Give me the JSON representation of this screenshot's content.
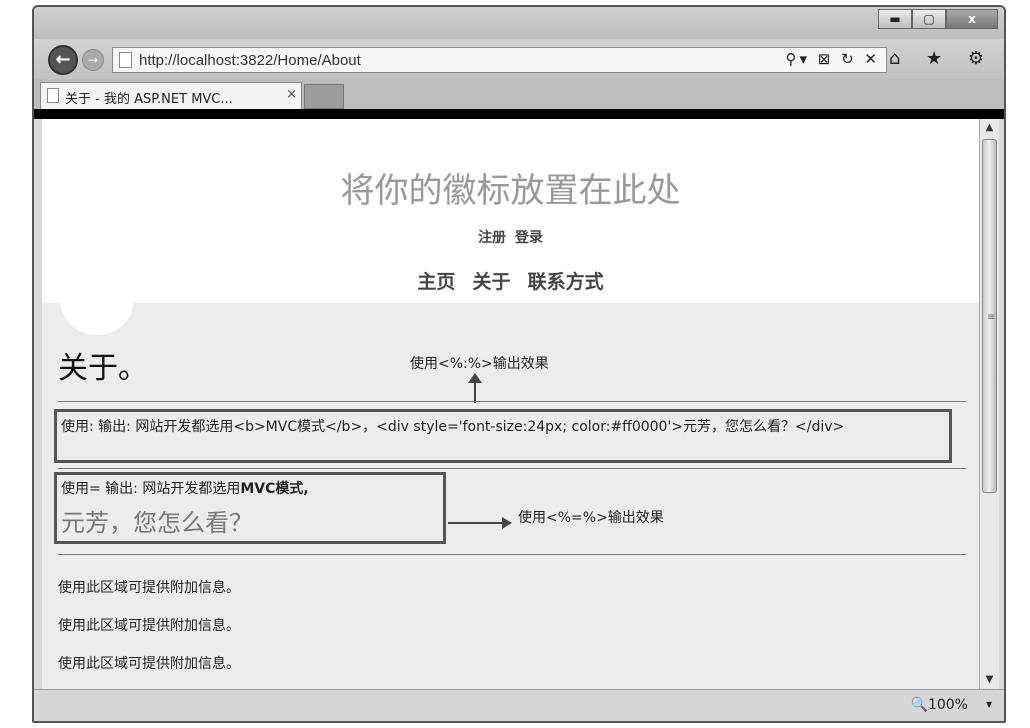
{
  "browser": {
    "url": "http://localhost:3822/Home/About",
    "tab_title": "关于 - 我的 ASP.NET MVC...",
    "tab_close": "×",
    "back_glyph": "←",
    "forward_glyph": "→",
    "address_tools": "⚲▾ ⊠ ↻ ✕",
    "chrome_icons": "⌂ ★ ⚙",
    "window_buttons": {
      "minimize": "▬",
      "maximize": "▢",
      "close": "x"
    },
    "zoom": "🔍100%",
    "zoom_dropdown": "▾"
  },
  "header": {
    "logo_text": "将你的徽标放置在此处",
    "login_links": "注册 登录",
    "menu": [
      "主页",
      "关于",
      "联系方式"
    ]
  },
  "main": {
    "page_title": "关于。",
    "annotation_1": "使用<%:%>输出效果",
    "box1_text": "使用: 输出: 网站开发都选用<b>MVC模式</b>，<div style='font-size:24px; color:#ff0000'>元芳，您怎么看？</div>",
    "box2_prefix": "使用= 输出: 网站开发都选用",
    "box2_bold": "MVC模式,",
    "box2_line2": "元芳，您怎么看？",
    "annotation_2": "使用<%=%>输出效果",
    "info_lines": [
      "使用此区域可提供附加信息。",
      "使用此区域可提供附加信息。",
      "使用此区域可提供附加信息。"
    ]
  },
  "scrollbar": {
    "up": "▲",
    "down": "▼",
    "grip": "≡"
  }
}
